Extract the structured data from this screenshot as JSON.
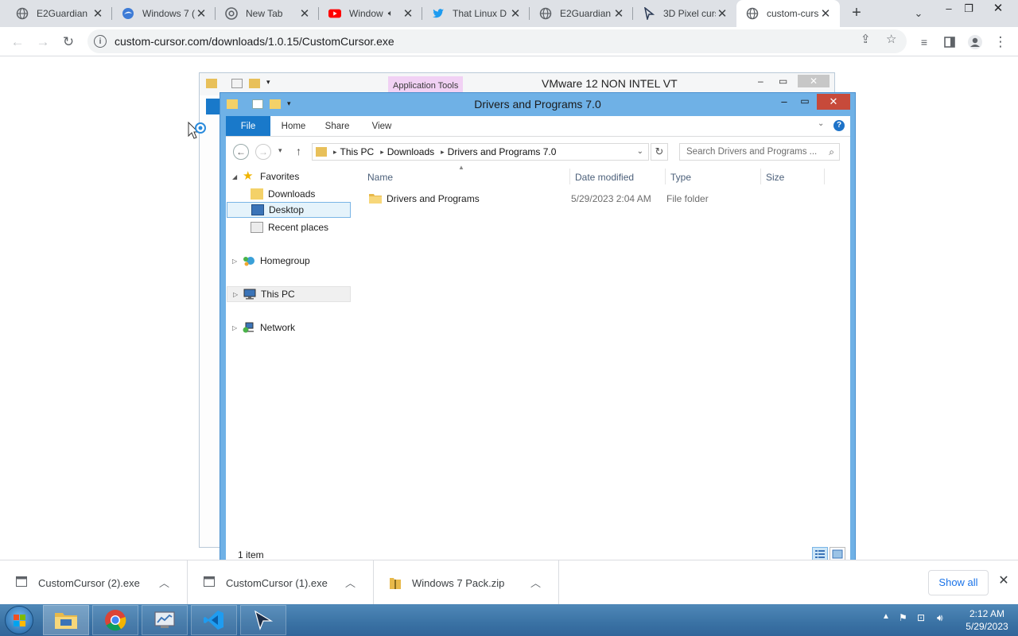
{
  "browser": {
    "tabs": [
      {
        "title": "E2Guardian",
        "icon": "globe-icon"
      },
      {
        "title": "Windows 7 (",
        "icon": "windows-tab-icon"
      },
      {
        "title": "New Tab",
        "icon": "chrome-icon"
      },
      {
        "title": "Window",
        "icon": "youtube-icon"
      },
      {
        "title": "That Linux D",
        "icon": "twitter-icon"
      },
      {
        "title": "E2Guardian",
        "icon": "globe-icon"
      },
      {
        "title": "3D Pixel curs",
        "icon": "cursor-icon"
      },
      {
        "title": "custom-curs",
        "icon": "globe-icon"
      }
    ],
    "url": "custom-cursor.com/downloads/1.0.15/CustomCursor.exe"
  },
  "bg_window": {
    "title": "VMware 12 NON INTEL VT",
    "context_tab": "Application Tools"
  },
  "explorer": {
    "title": "Drivers and Programs 7.0",
    "ribbon_tabs": [
      "File",
      "Home",
      "Share",
      "View"
    ],
    "breadcrumb": [
      "This PC",
      "Downloads",
      "Drivers and Programs 7.0"
    ],
    "search_placeholder": "Search Drivers and Programs ...",
    "nav": {
      "favorites": "Favorites",
      "downloads": "Downloads",
      "desktop": "Desktop",
      "recent": "Recent places",
      "homegroup": "Homegroup",
      "thispc": "This PC",
      "network": "Network"
    },
    "columns": [
      "Name",
      "Date modified",
      "Type",
      "Size"
    ],
    "files": [
      {
        "name": "Drivers and Programs",
        "date": "5/29/2023 2:04 AM",
        "type": "File folder",
        "size": ""
      }
    ],
    "status": "1 item"
  },
  "downloads": [
    {
      "name": "CustomCursor (2).exe"
    },
    {
      "name": "CustomCursor (1).exe"
    },
    {
      "name": "Windows 7 Pack.zip"
    }
  ],
  "downloads_show_all": "Show all",
  "taskbar": {
    "time": "2:12 AM",
    "date": "5/29/2023"
  },
  "colors": {
    "explorer_frame": "#6fb1e6",
    "file_tab": "#1979ca",
    "close_button": "#c74a3a",
    "taskbar": "#3a72a4"
  }
}
